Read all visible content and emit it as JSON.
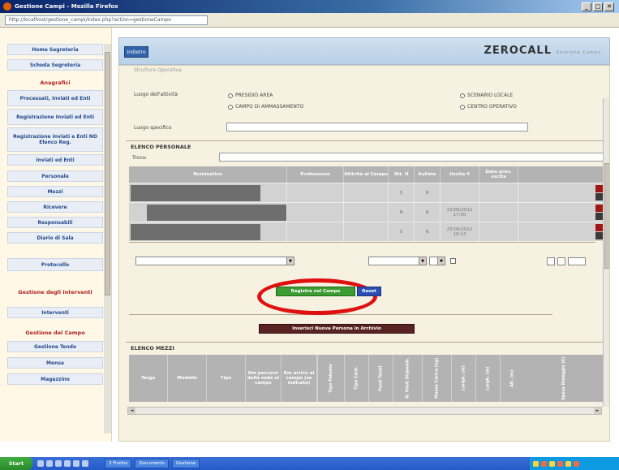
{
  "window": {
    "title": "Gestione Campi - Mozilla Firefox",
    "controls": [
      "_",
      "□",
      "✕"
    ]
  },
  "address_bar": {
    "url": "http://localhost/gestione_campi/index.php?action=gestioneCampo"
  },
  "sidebar": {
    "top_items": [
      "Home Segreteria",
      "Scheda Segreteria"
    ],
    "section1_title": "Anagrafici",
    "section1_items": [
      "Processati, Inviati ed Enti",
      "Registrazione Inviati ed Enti",
      "Registrazione Inviati e Enti NO Elenco Reg.",
      "Inviati ed Enti",
      "Personale",
      "Mezzi",
      "Ricevere",
      "Responsabili",
      "Diario di Sala"
    ],
    "protocol_item": "Protocollo",
    "section2_title": "Gestione degli Interventi",
    "section2_items": [
      "Interventi"
    ],
    "section3_title": "Gestione del Campo",
    "section3_items": [
      "Gestione Tende",
      "Mensa",
      "Magazzino"
    ]
  },
  "toolbar": {
    "back_label": "Indietro",
    "logo": "ZEROCALL",
    "logo_sub": "Gestione Campo"
  },
  "form": {
    "truncated_label": "Struttura Operativa",
    "location_label": "Luogo dell'attività",
    "radio_options": [
      "PRESIDIO AREA",
      "CAMPO DI AMMASSAMENTO",
      "SCENARIO LOCALE",
      "CENTRO OPERATIVO"
    ],
    "specific_place_label": "Luogo specifico"
  },
  "personnel": {
    "section_title": "ELENCO PERSONALE",
    "search_label": "Trova:",
    "columns": [
      "Nominativo",
      "Professione",
      "Attività al Campo",
      "Att. H",
      "Autista",
      "Uscita il",
      "Data prev. uscita"
    ],
    "rows": [
      {
        "name": "",
        "profession": "",
        "activity": "",
        "att_h": "S",
        "driver": "N",
        "exit": "",
        "planned_exit": ""
      },
      {
        "name": "",
        "profession": "",
        "activity": "",
        "att_h": "N",
        "driver": "N",
        "exit": "22/09/2012 17:00",
        "planned_exit": ""
      },
      {
        "name": "",
        "profession": "",
        "activity": "",
        "att_h": "S",
        "driver": "N",
        "exit": "25/09/2012 19:14",
        "planned_exit": ""
      }
    ],
    "row_actions": [
      "Elimina",
      "Modifica"
    ],
    "register_button": "Registra nel Campo",
    "reset_button": "Reset",
    "new_person_button": "Inserisci Nuova Persona in Archivio"
  },
  "vehicles": {
    "section_title": "ELENCO MEZZI",
    "columns": [
      "Targa",
      "Modello",
      "Tipo",
      "Km percorsi dalla sede al campo",
      "Km arrivo al campo (se indicato)",
      "Tipo Patente",
      "Tipo Carb.",
      "Posti Totali",
      "N. Posti Disponib.",
      "Massa Carico (kg)",
      "Lungh. (m)",
      "Largh. (m)",
      "Alt. (m)",
      "Spesa Noleggio (€)"
    ]
  },
  "taskbar": {
    "start_label": "Start",
    "tasks": [
      "3 Firefox",
      "Documents",
      "Gestione"
    ]
  }
}
